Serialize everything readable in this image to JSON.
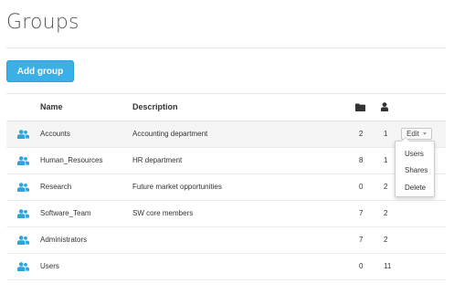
{
  "page": {
    "title": "Groups",
    "add_button_label": "Add group"
  },
  "table": {
    "headers": {
      "name": "Name",
      "description": "Description",
      "shares_icon": "folder-icon",
      "users_icon": "user-icon"
    },
    "rows": [
      {
        "name": "Accounts",
        "description": "Accounting department",
        "shares": "2",
        "users": "1",
        "icon": "group-icon"
      },
      {
        "name": "Human_Resources",
        "description": "HR department",
        "shares": "8",
        "users": "1",
        "icon": "group-icon"
      },
      {
        "name": "Research",
        "description": "Future market opportunities",
        "shares": "0",
        "users": "2",
        "icon": "group-icon"
      },
      {
        "name": "Software_Team",
        "description": "SW core members",
        "shares": "7",
        "users": "2",
        "icon": "group-icon"
      },
      {
        "name": "Administrators",
        "description": "",
        "shares": "7",
        "users": "2",
        "icon": "group-icon"
      },
      {
        "name": "Users",
        "description": "",
        "shares": "0",
        "users": "11",
        "icon": "group-icon"
      }
    ],
    "edit_button_label": "Edit"
  },
  "edit_menu": {
    "items": [
      "Users",
      "Shares",
      "Delete"
    ]
  },
  "colors": {
    "accent": "#3bb0e8",
    "group_icon": "#2fa4dc",
    "header_icon": "#333333"
  }
}
